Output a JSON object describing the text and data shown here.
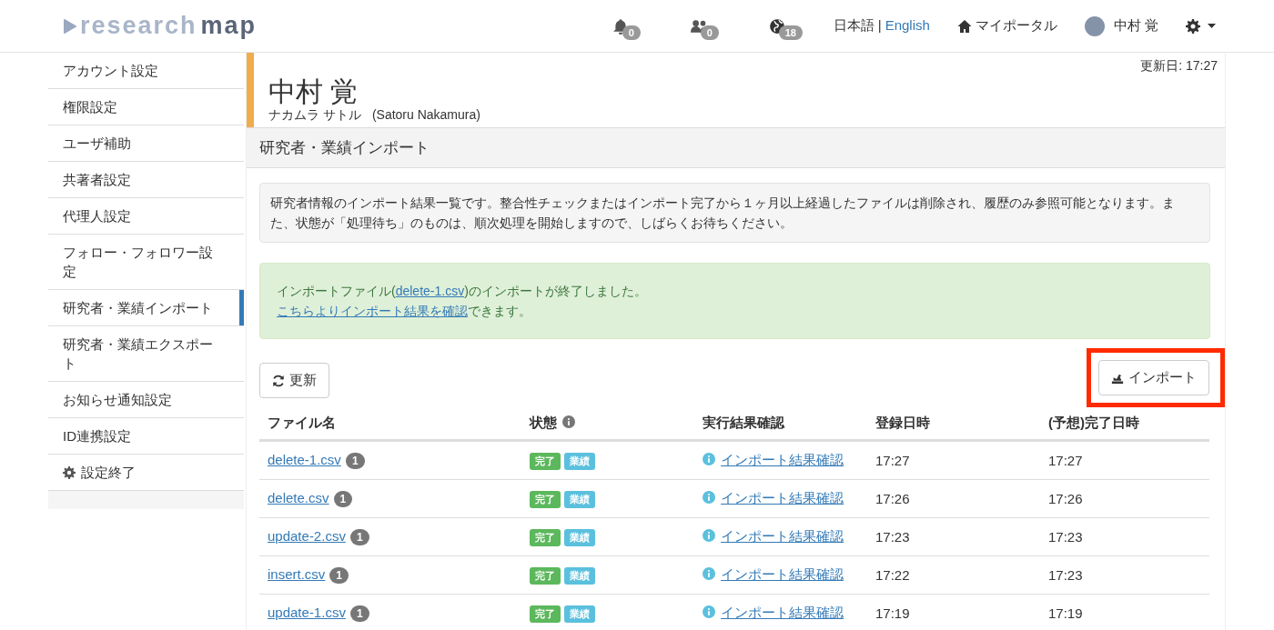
{
  "header": {
    "logo": {
      "light": "research",
      "dark": "map"
    },
    "notifications": [
      {
        "kind": "bell",
        "count": "0"
      },
      {
        "kind": "people",
        "count": "0"
      },
      {
        "kind": "globe",
        "count": "18"
      }
    ],
    "languages": [
      {
        "label": "日本語",
        "selected": true
      },
      {
        "label": "English",
        "selected": false
      }
    ],
    "language_separator": "|",
    "portal": "マイポータル",
    "user": "中村 覚"
  },
  "sidebar": {
    "items": [
      {
        "label": "アカウント設定",
        "selected": false
      },
      {
        "label": "権限設定",
        "selected": false
      },
      {
        "label": "ユーザ補助",
        "selected": false
      },
      {
        "label": "共著者設定",
        "selected": false
      },
      {
        "label": "代理人設定",
        "selected": false
      },
      {
        "label": "フォロー・フォロワー設定",
        "selected": false
      },
      {
        "label": "研究者・業績インポート",
        "selected": true
      },
      {
        "label": "研究者・業績エクスポート",
        "selected": false
      },
      {
        "label": "お知らせ通知設定",
        "selected": false
      },
      {
        "label": "ID連携設定",
        "selected": false
      },
      {
        "label": "設定終了",
        "selected": false,
        "kind": "gear"
      }
    ]
  },
  "profile": {
    "updated": "更新日: 17:27",
    "name": "中村 覚",
    "kana": "ナカムラ サトル",
    "roman": "(Satoru Nakamura)"
  },
  "section_title": "研究者・業績インポート",
  "info_text": "研究者情報のインポート結果一覧です。整合性チェックまたはインポート完了から１ヶ月以上経過したファイルは削除され、履歴のみ参照可能となります。また、状態が「処理待ち」のものは、順次処理を開始しますので、しばらくお待ちください。",
  "success": {
    "before": "インポートファイル(",
    "file_link": "delete-1.csv",
    "after": ")のインポートが終了しました。",
    "result_link": "こちらよりインポート結果を確認",
    "result_after": "できます。"
  },
  "refresh_button": "更新",
  "import_button": {
    "label": "インポート",
    "highlighted": true
  },
  "table": {
    "columns": [
      "ファイル名",
      "状態",
      "実行結果確認",
      "登録日時",
      "(予想)完了日時"
    ],
    "rows": [
      {
        "file": "delete-1.csv",
        "count": "1",
        "badges": [
          {
            "text": "完了",
            "color": "#5cb85c"
          },
          {
            "text": "業績",
            "color": "#5bc0de"
          }
        ],
        "result": "インポート結果確認",
        "registered": "17:27",
        "completed": "17:27"
      },
      {
        "file": "delete.csv",
        "count": "1",
        "badges": [
          {
            "text": "完了",
            "color": "#5cb85c"
          },
          {
            "text": "業績",
            "color": "#5bc0de"
          }
        ],
        "result": "インポート結果確認",
        "registered": "17:26",
        "completed": "17:26"
      },
      {
        "file": "update-2.csv",
        "count": "1",
        "badges": [
          {
            "text": "完了",
            "color": "#5cb85c"
          },
          {
            "text": "業績",
            "color": "#5bc0de"
          }
        ],
        "result": "インポート結果確認",
        "registered": "17:23",
        "completed": "17:23"
      },
      {
        "file": "insert.csv",
        "count": "1",
        "badges": [
          {
            "text": "完了",
            "color": "#5cb85c"
          },
          {
            "text": "業績",
            "color": "#5bc0de"
          }
        ],
        "result": "インポート結果確認",
        "registered": "17:22",
        "completed": "17:23"
      },
      {
        "file": "update-1.csv",
        "count": "1",
        "badges": [
          {
            "text": "完了",
            "color": "#5cb85c"
          },
          {
            "text": "業績",
            "color": "#5bc0de"
          }
        ],
        "result": "インポート結果確認",
        "registered": "17:19",
        "completed": "17:19"
      }
    ]
  }
}
